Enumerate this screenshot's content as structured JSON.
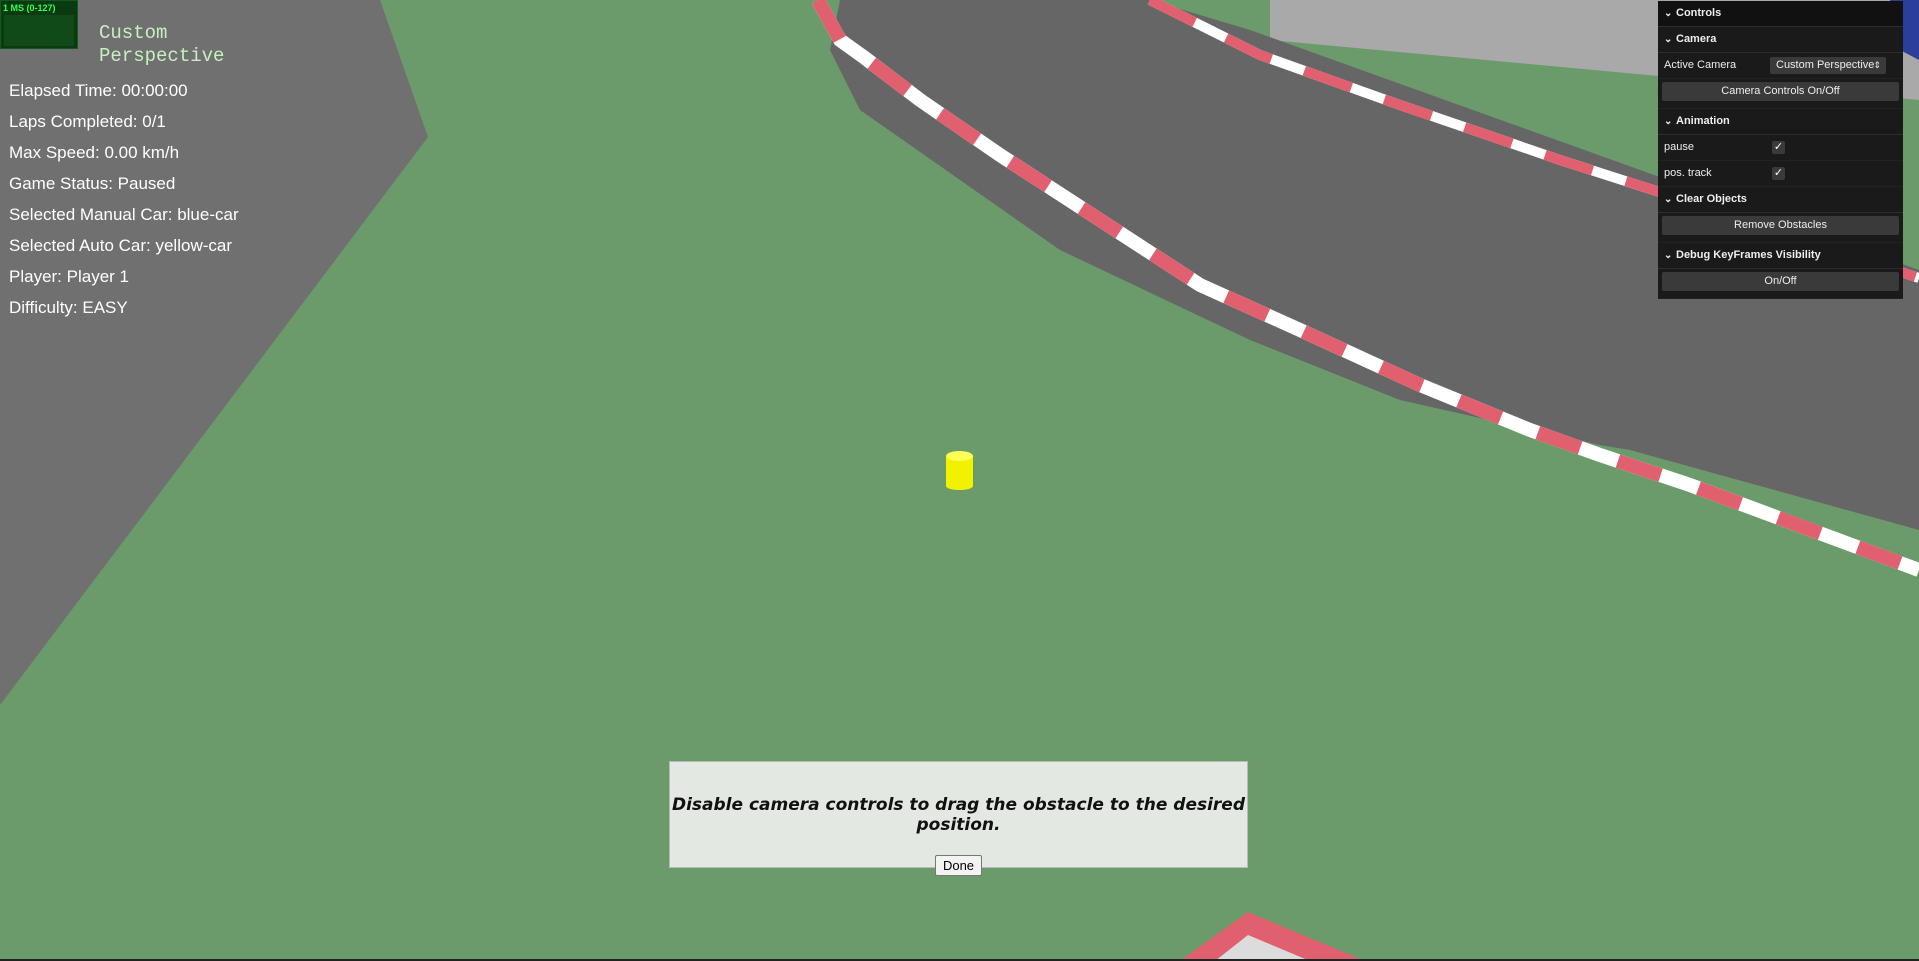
{
  "perf": {
    "label": "1 MS (0-127)"
  },
  "camera_name": "Custom Perspective",
  "stats": [
    "Elapsed Time: 00:00:00",
    "Laps Completed: 0/1",
    "Max Speed: 0.00 km/h",
    "Game Status: Paused",
    "Selected Manual Car: blue-car",
    "Selected Auto Car: yellow-car",
    "Player: Player 1",
    "Difficulty: EASY"
  ],
  "gui": {
    "title": "Controls",
    "camera": {
      "folder": "Camera",
      "active_label": "Active Camera",
      "active_value": "Custom Perspective",
      "controls_button": "Camera Controls On/Off"
    },
    "animation": {
      "folder": "Animation",
      "pause_label": "pause",
      "pause_checked": true,
      "pos_track_label": "pos. track",
      "pos_track_checked": true
    },
    "clear": {
      "folder": "Clear Objects",
      "remove_button": "Remove Obstacles"
    },
    "debug": {
      "folder": "Debug KeyFrames Visibility",
      "toggle_button": "On/Off"
    }
  },
  "dialog": {
    "message": "Disable camera controls to drag the obstacle to the desired position.",
    "done_label": "Done"
  },
  "colors": {
    "grass": "#6b9b6b",
    "road": "#6b6b6b",
    "curb_red": "#e06070",
    "obstacle": "#ffff00"
  }
}
